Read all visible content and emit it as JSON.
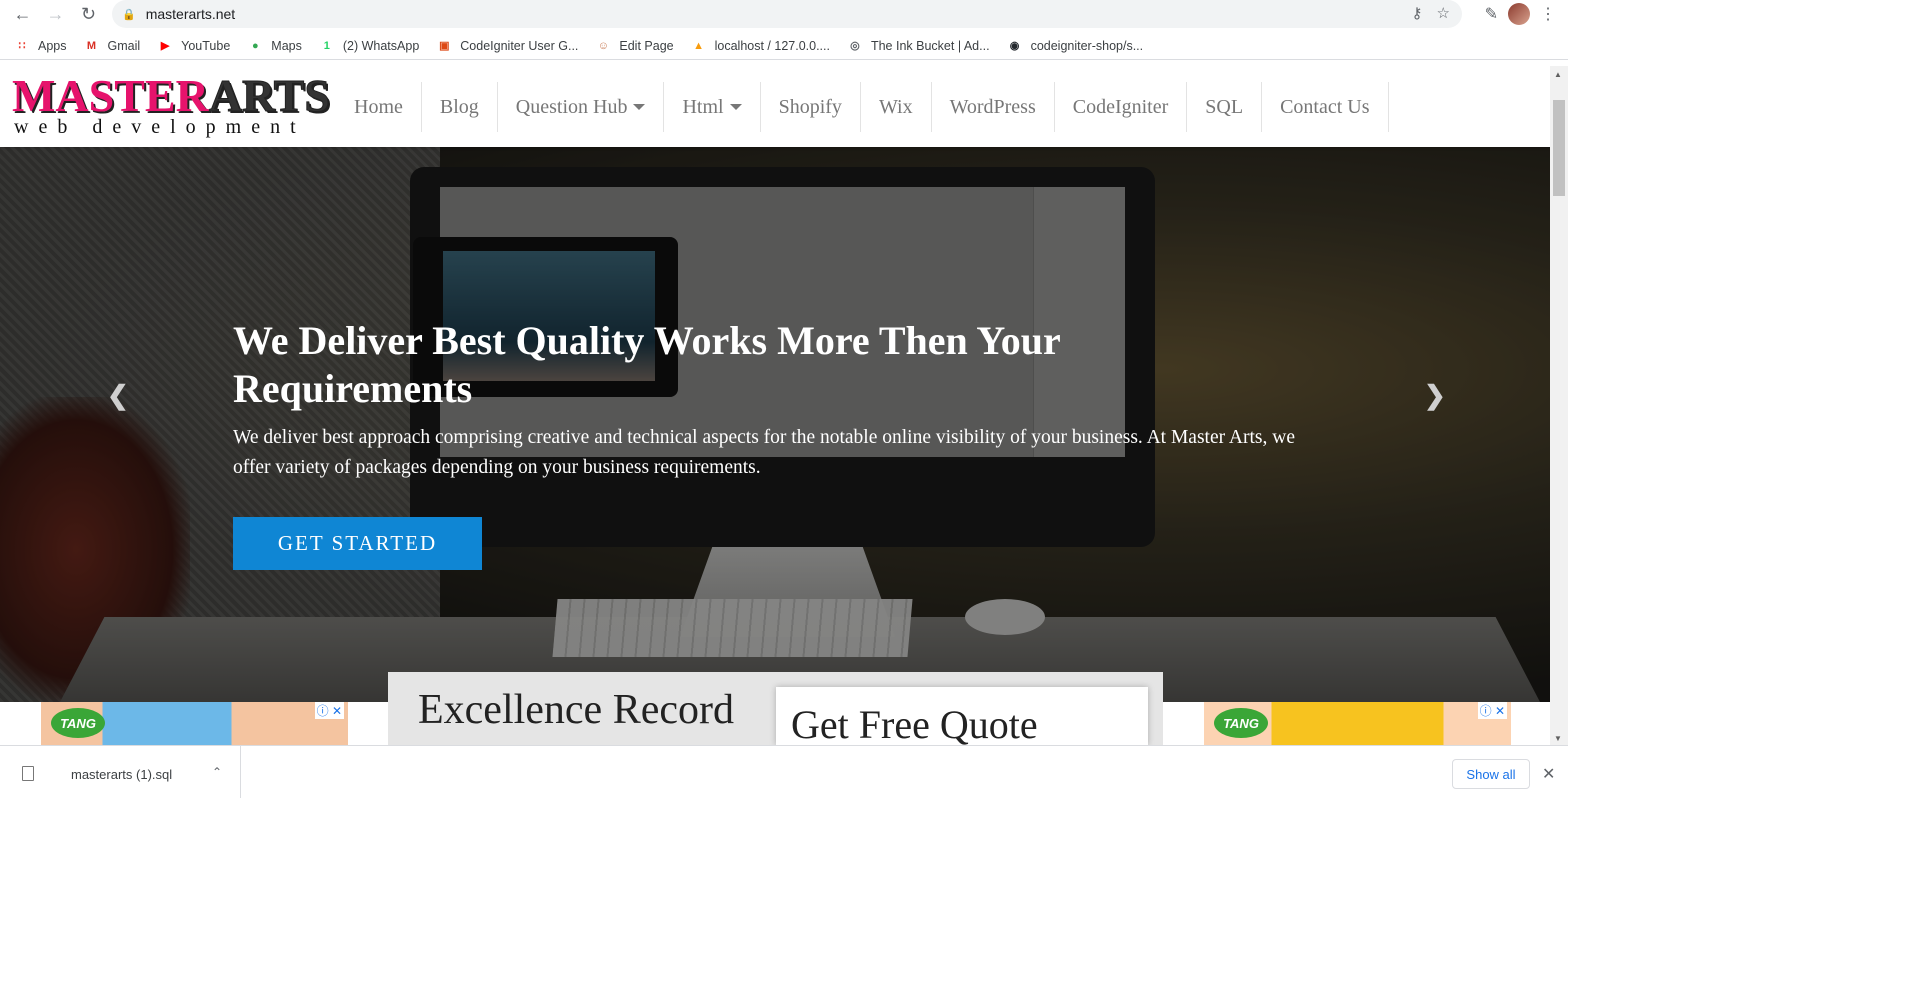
{
  "browser": {
    "url": "masterarts.net",
    "bookmarks": [
      {
        "label": "Apps",
        "icon": "apps-grid-icon",
        "color": "#ea4335"
      },
      {
        "label": "Gmail",
        "icon": "gmail-icon",
        "color": "#d93025"
      },
      {
        "label": "YouTube",
        "icon": "youtube-icon",
        "color": "#ff0000"
      },
      {
        "label": "Maps",
        "icon": "maps-pin-icon",
        "color": "#34a853"
      },
      {
        "label": "(2) WhatsApp",
        "icon": "whatsapp-icon",
        "color": "#25d366"
      },
      {
        "label": "CodeIgniter User G...",
        "icon": "codeigniter-icon",
        "color": "#dd4814"
      },
      {
        "label": "Edit Page",
        "icon": "person-icon",
        "color": "#c87b55"
      },
      {
        "label": "localhost / 127.0.0....",
        "icon": "phpmyadmin-icon",
        "color": "#f89c0e"
      },
      {
        "label": "The Ink Bucket | Ad...",
        "icon": "globe-icon",
        "color": "#5f6368"
      },
      {
        "label": "codeigniter-shop/s...",
        "icon": "github-icon",
        "color": "#24292e"
      }
    ]
  },
  "site": {
    "logo_main": "MASTER",
    "logo_accent": "ARTS",
    "logo_sub": "web development",
    "nav": [
      {
        "label": "Home",
        "dropdown": false
      },
      {
        "label": "Blog",
        "dropdown": false
      },
      {
        "label": "Question Hub",
        "dropdown": true
      },
      {
        "label": "Html",
        "dropdown": true
      },
      {
        "label": "Shopify",
        "dropdown": false
      },
      {
        "label": "Wix",
        "dropdown": false
      },
      {
        "label": "WordPress",
        "dropdown": false
      },
      {
        "label": "CodeIgniter",
        "dropdown": false
      },
      {
        "label": "SQL",
        "dropdown": false
      },
      {
        "label": "Contact Us",
        "dropdown": false
      }
    ]
  },
  "hero": {
    "title": "We Deliver Best Quality Works More Then Your Requirements",
    "description": "We deliver best approach comprising creative and technical aspects for the notable online visibility of your business. At Master Arts, we offer variety of packages depending on your business requirements.",
    "cta_label": "GET STARTED",
    "accent": "#0f86d4"
  },
  "ads": {
    "brand": "TANG"
  },
  "sections": {
    "excellence": "Excellence Record",
    "quote": "Get Free Quote"
  },
  "downloads": {
    "file_name": "masterarts (1).sql",
    "show_all": "Show all"
  }
}
